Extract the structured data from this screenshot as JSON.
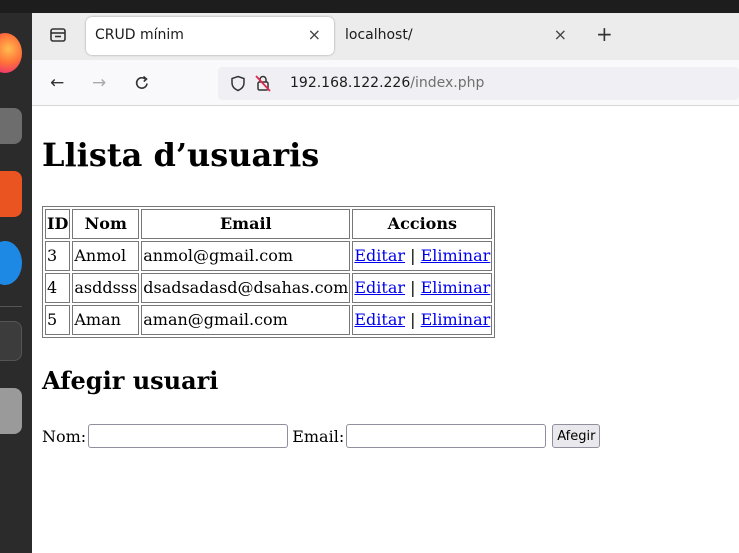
{
  "browser": {
    "tabs": [
      {
        "title": "CRUD mínim",
        "active": true
      },
      {
        "title": "localhost/",
        "active": false
      }
    ],
    "new_tab_label": "+",
    "close_label": "×",
    "url_host": "192.168.122.226",
    "url_path": "/index.php"
  },
  "page": {
    "title": "Llista d’usuaris",
    "table": {
      "headers": [
        "ID",
        "Nom",
        "Email",
        "Accions"
      ],
      "rows": [
        {
          "id": "3",
          "nom": "Anmol",
          "email": "anmol@gmail.com",
          "edit": "Editar",
          "sep": "|",
          "delete": "Eliminar"
        },
        {
          "id": "4",
          "nom": "asddsss",
          "email": "dsadsadasd@dsahas.com",
          "edit": "Editar",
          "sep": "|",
          "delete": "Eliminar"
        },
        {
          "id": "5",
          "nom": "Aman",
          "email": "aman@gmail.com",
          "edit": "Editar",
          "sep": "|",
          "delete": "Eliminar"
        }
      ]
    },
    "form": {
      "title": "Afegir usuari",
      "nom_label": "Nom:",
      "nom_value": "",
      "email_label": "Email:",
      "email_value": "",
      "submit_label": "Afegir"
    }
  },
  "colors": {
    "link": "#0000ee",
    "dock": "#2b2b2b",
    "tabbar": "#ececec"
  }
}
